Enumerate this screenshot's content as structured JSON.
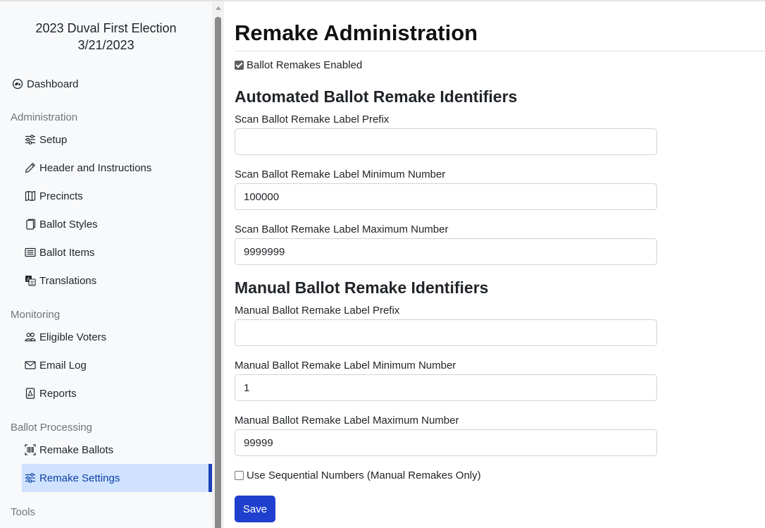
{
  "sidebar": {
    "election_name": "2023 Duval First Election",
    "election_date": "3/21/2023",
    "dashboard_label": "Dashboard",
    "sections": {
      "administration": "Administration",
      "monitoring": "Monitoring",
      "ballot_processing": "Ballot Processing",
      "tools": "Tools"
    },
    "items": {
      "setup": "Setup",
      "header_instructions": "Header and Instructions",
      "precincts": "Precincts",
      "ballot_styles": "Ballot Styles",
      "ballot_items": "Ballot Items",
      "translations": "Translations",
      "eligible_voters": "Eligible Voters",
      "email_log": "Email Log",
      "reports": "Reports",
      "remake_ballots": "Remake Ballots",
      "remake_settings": "Remake Settings"
    },
    "active_item": "Remake Settings"
  },
  "main": {
    "title": "Remake Administration",
    "remakes_enabled": {
      "label": "Ballot Remakes Enabled",
      "checked": true
    },
    "automated": {
      "heading": "Automated Ballot Remake Identifiers",
      "prefix_label": "Scan Ballot Remake Label Prefix",
      "prefix_value": "",
      "min_label": "Scan Ballot Remake Label Minimum Number",
      "min_value": "100000",
      "max_label": "Scan Ballot Remake Label Maximum Number",
      "max_value": "9999999"
    },
    "manual": {
      "heading": "Manual Ballot Remake Identifiers",
      "prefix_label": "Manual Ballot Remake Label Prefix",
      "prefix_value": "",
      "min_label": "Manual Ballot Remake Label Minimum Number",
      "min_value": "1",
      "max_label": "Manual Ballot Remake Label Maximum Number",
      "max_value": "99999"
    },
    "sequential": {
      "label": "Use Sequential Numbers (Manual Remakes Only)",
      "checked": false
    },
    "save_label": "Save"
  },
  "colors": {
    "active_bg": "#cfe2ff",
    "active_border": "#1d3fb8",
    "primary_button": "#1f3fce"
  }
}
